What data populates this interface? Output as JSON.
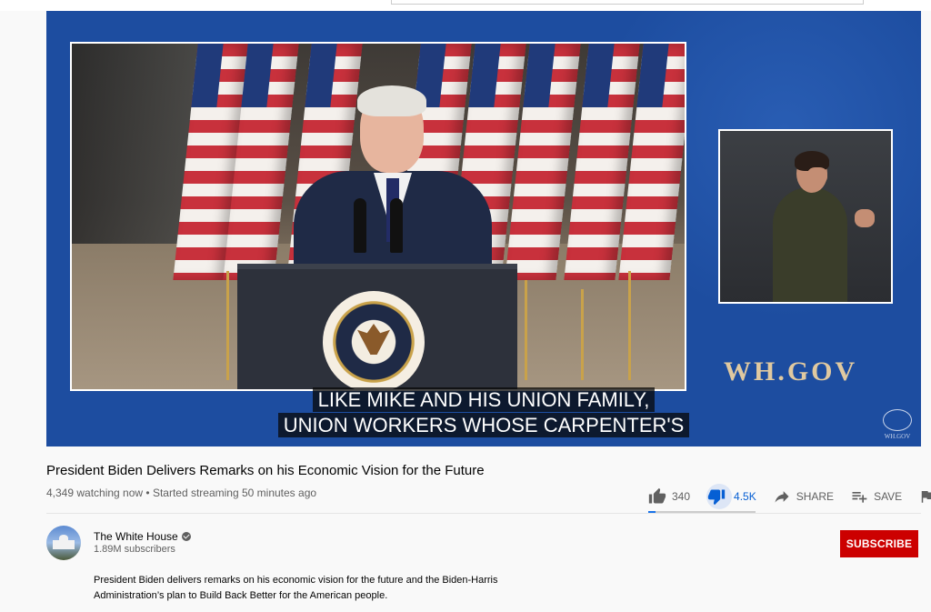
{
  "video": {
    "caption_line1": "LIKE MIKE AND HIS UNION FAMILY,",
    "caption_line2": "UNION WORKERS WHOSE CARPENTER'S",
    "watermark": "WH.GOV",
    "corner_logo_text": "WH.GOV"
  },
  "info": {
    "title": "President Biden Delivers Remarks on his Economic Vision for the Future",
    "meta": "4,349 watching now • Started streaming 50 minutes ago"
  },
  "actions": {
    "like_count": "340",
    "dislike_count": "4.5K",
    "share_label": "SHARE",
    "save_label": "SAVE",
    "like_ratio_percent": 7
  },
  "channel": {
    "name": "The White House",
    "subscribers": "1.89M subscribers",
    "subscribe_label": "SUBSCRIBE"
  },
  "description": {
    "line1": "President Biden delivers remarks on his economic vision for the future and the Biden-Harris",
    "line2": "Administration’s plan to Build Back Better for the American people."
  },
  "colors": {
    "video_bg": "#1d4da0",
    "subscribe_red": "#cc0000",
    "link_blue": "#065fd4",
    "watermark_gold": "#e0c9a0"
  },
  "icons": [
    "thumbs-up-icon",
    "thumbs-down-icon",
    "share-icon",
    "playlist-add-icon",
    "flag-icon",
    "verified-icon"
  ]
}
